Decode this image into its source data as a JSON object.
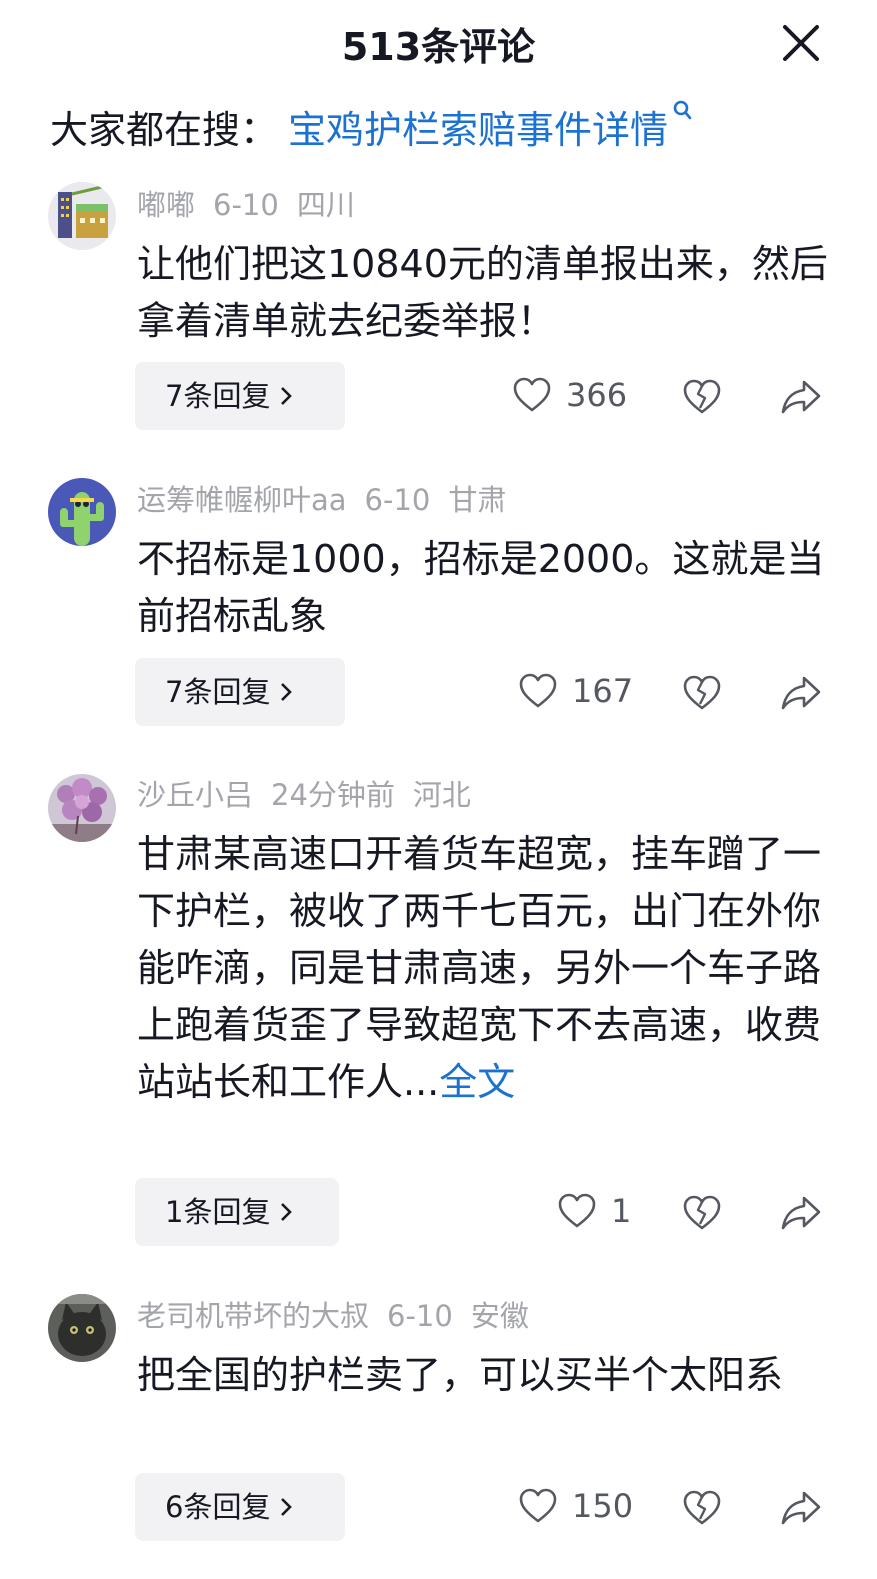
{
  "header": {
    "title": "513条评论"
  },
  "search": {
    "prefix": "大家都在搜：",
    "query": "宝鸡护栏索赔事件详情"
  },
  "colors": {
    "accent": "#1c72d1",
    "meta_gray": "#a3a5ab",
    "button_bg": "#f2f2f4"
  },
  "comments": [
    {
      "user": "嘟嘟",
      "date": "6-10",
      "location": "四川",
      "text": "让他们把这10840元的清单报出来，然后拿着清单就去纪委举报！",
      "more": "",
      "replies": "7条回复",
      "likes": "366",
      "avatar_icon": "building-avatar"
    },
    {
      "user": "运筹帷幄柳叶aa",
      "date": "6-10",
      "location": "甘肃",
      "text": "不招标是1000，招标是2000。这就是当前招标乱象",
      "more": "",
      "replies": "7条回复",
      "likes": "167",
      "avatar_icon": "cactus-avatar"
    },
    {
      "user": "沙丘小吕",
      "date": "24分钟前",
      "location": "河北",
      "text": "甘肃某高速口开着货车超宽，挂车蹭了一下护栏，被收了两千七百元，出门在外你能咋滴，同是甘肃高速，另外一个车子路上跑着货歪了导致超宽下不去高速，收费站站长和工作人...",
      "more": "全文",
      "replies": "1条回复",
      "likes": "1",
      "avatar_icon": "flower-avatar"
    },
    {
      "user": "老司机带坏的大叔",
      "date": "6-10",
      "location": "安徽",
      "text": "把全国的护栏卖了，可以买半个太阳系",
      "more": "",
      "replies": "6条回复",
      "likes": "150",
      "avatar_icon": "cat-avatar"
    }
  ]
}
